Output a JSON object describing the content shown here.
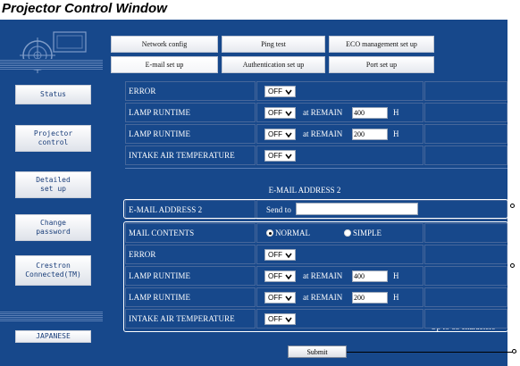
{
  "window": {
    "title": "Projector Control Window"
  },
  "sidebar": {
    "items": [
      {
        "label": "Status"
      },
      {
        "label": "Projector\ncontrol"
      },
      {
        "label": "Detailed\nset up"
      },
      {
        "label": "Change\npassword"
      },
      {
        "label": "Crestron\nConnected(TM)"
      }
    ],
    "language_button": "JAPANESE"
  },
  "tabs": {
    "row1": [
      "Network config",
      "Ping test",
      "ECO management set up"
    ],
    "row2": [
      "E-mail set up",
      "Authentication set up",
      "Port set up"
    ],
    "active": "E-mail set up"
  },
  "address1_block": {
    "rows": [
      {
        "label": "ERROR",
        "select": "OFF"
      },
      {
        "label": "LAMP RUNTIME",
        "select": "OFF",
        "remain_label": "at REMAIN",
        "remain_value": "400",
        "unit": "H"
      },
      {
        "label": "LAMP RUNTIME",
        "select": "OFF",
        "remain_label": "at REMAIN",
        "remain_value": "200",
        "unit": "H"
      },
      {
        "label": "INTAKE AIR TEMPERATURE",
        "select": "OFF"
      }
    ]
  },
  "address2_block": {
    "section_title": "E-MAIL ADDRESS 2",
    "address_label": "E-MAIL ADDRESS 2",
    "send_to_label": "Send to",
    "send_to_value": "",
    "limit_note": "Up to 63 characters",
    "mail_contents_label": "MAIL CONTENTS",
    "mail_contents_options": [
      "NORMAL",
      "SIMPLE"
    ],
    "mail_contents_selected": "NORMAL",
    "rows": [
      {
        "label": "ERROR",
        "select": "OFF"
      },
      {
        "label": "LAMP RUNTIME",
        "select": "OFF",
        "remain_label": "at REMAIN",
        "remain_value": "400",
        "unit": "H"
      },
      {
        "label": "LAMP RUNTIME",
        "select": "OFF",
        "remain_label": "at REMAIN",
        "remain_value": "200",
        "unit": "H"
      },
      {
        "label": "INTAKE AIR TEMPERATURE",
        "select": "OFF"
      }
    ]
  },
  "submit_label": "Submit",
  "colors": {
    "frame": "#17488b",
    "cell_border": "#46679b",
    "text": "#ffffff"
  }
}
